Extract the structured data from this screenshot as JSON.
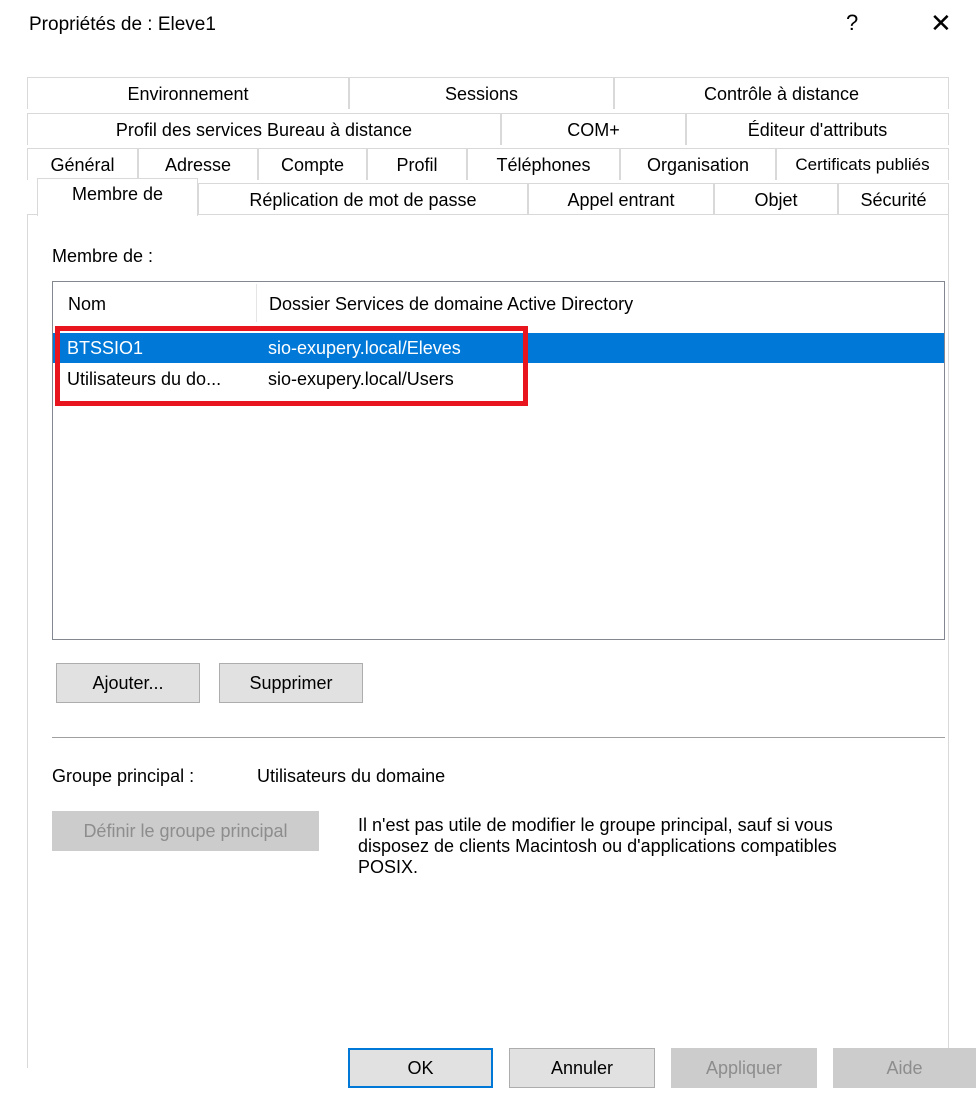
{
  "window": {
    "title": "Propriétés de : Eleve1",
    "help_glyph": "?",
    "close_glyph": "✕"
  },
  "tabs": {
    "row1": [
      "Environnement",
      "Sessions",
      "Contrôle à distance"
    ],
    "row2": [
      "Profil des services Bureau à distance",
      "COM+",
      "Éditeur d'attributs"
    ],
    "row3": [
      "Général",
      "Adresse",
      "Compte",
      "Profil",
      "Téléphones",
      "Organisation",
      "Certificats publiés"
    ],
    "row4": [
      "Membre de",
      "Réplication de mot de passe",
      "Appel entrant",
      "Objet",
      "Sécurité"
    ],
    "selected": "Membre de"
  },
  "member_of": {
    "label": "Membre de :",
    "columns": [
      "Nom",
      "Dossier Services de domaine Active Directory"
    ],
    "rows": [
      {
        "name": "BTSSIO1",
        "folder": "sio-exupery.local/Eleves",
        "selected": true
      },
      {
        "name": "Utilisateurs du do...",
        "folder": "sio-exupery.local/Users",
        "selected": false
      }
    ],
    "add_button": "Ajouter...",
    "remove_button": "Supprimer"
  },
  "primary_group": {
    "label": "Groupe principal :",
    "value": "Utilisateurs du domaine",
    "set_button": "Définir le groupe principal",
    "info_line1": "Il n'est pas utile de modifier le groupe principal, sauf si vous",
    "info_line2": "disposez de clients Macintosh ou d'applications compatibles",
    "info_line3": "POSIX."
  },
  "footer": {
    "ok": "OK",
    "cancel": "Annuler",
    "apply": "Appliquer",
    "help": "Aide"
  },
  "colors": {
    "selection": "#0078d7",
    "annotation_box": "#e8141e"
  }
}
